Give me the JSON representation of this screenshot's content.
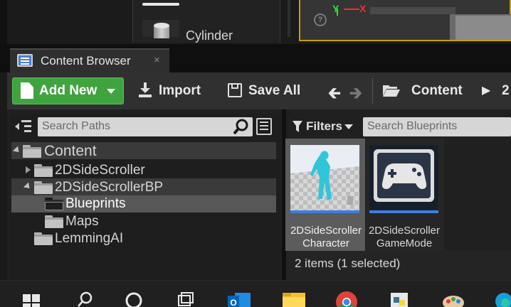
{
  "modes_panel": {
    "cylinder_label": "Cylinder"
  },
  "viewport": {
    "axis_y": "Y",
    "axis_x": "X",
    "gizmo": "?"
  },
  "tab": {
    "title": "Content Browser",
    "close": "×"
  },
  "toolbar": {
    "add_new": "Add New",
    "import": "Import",
    "save_all": "Save All",
    "back": "🡰",
    "forward": "🡲",
    "crumb_root": "Content",
    "crumb_arrow": "▶",
    "crumb_next": "2"
  },
  "sources": {
    "search_placeholder": "Search Paths",
    "tree": [
      {
        "label": "Content",
        "depth": 0,
        "expanded": true
      },
      {
        "label": "2DSideScroller",
        "depth": 1,
        "expanded": false
      },
      {
        "label": "2DSideScrollerBP",
        "depth": 1,
        "expanded": true
      },
      {
        "label": "Blueprints",
        "depth": 2,
        "selected": true
      },
      {
        "label": "Maps",
        "depth": 2
      },
      {
        "label": "LemmingAI",
        "depth": 1
      }
    ]
  },
  "assets": {
    "filters_label": "Filters",
    "search_placeholder": "Search Blueprints",
    "items": [
      {
        "label_line1": "2DSideScroller",
        "label_line2": "Character",
        "selected": true
      },
      {
        "label_line1": "2DSideScroller",
        "label_line2": "GameMode",
        "selected": false
      }
    ],
    "status": "2 items (1 selected)"
  },
  "taskbar": {
    "icons": [
      "windows-start-icon",
      "search-icon",
      "cortana-icon",
      "task-view-icon",
      "outlook-icon",
      "file-explorer-icon",
      "chrome-icon",
      "python-icon",
      "paint-icon",
      "edge-icon"
    ]
  },
  "colors": {
    "accent_green": "#3fa43f",
    "selection_blue": "#3f7fdc",
    "viewport_border": "#c8a000"
  }
}
